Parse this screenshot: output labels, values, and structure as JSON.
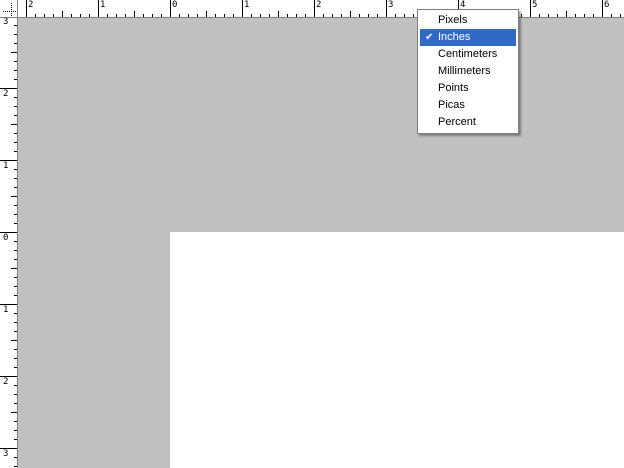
{
  "ruler": {
    "unit": "Inches",
    "top_labels": [
      "2",
      "1",
      "0",
      "1",
      "2",
      "3",
      "4",
      "5",
      "6"
    ],
    "left_labels": [
      "3",
      "2",
      "1",
      "0",
      "1",
      "2",
      "3"
    ]
  },
  "unit_menu": {
    "items": [
      {
        "label": "Pixels",
        "checked": false
      },
      {
        "label": "Inches",
        "checked": true
      },
      {
        "label": "Centimeters",
        "checked": false
      },
      {
        "label": "Millimeters",
        "checked": false
      },
      {
        "label": "Points",
        "checked": false
      },
      {
        "label": "Picas",
        "checked": false
      },
      {
        "label": "Percent",
        "checked": false
      }
    ],
    "check_glyph": "✔"
  },
  "colors": {
    "pasteboard": "#c0c0c0",
    "page": "#ffffff",
    "selection": "#316ac5"
  }
}
